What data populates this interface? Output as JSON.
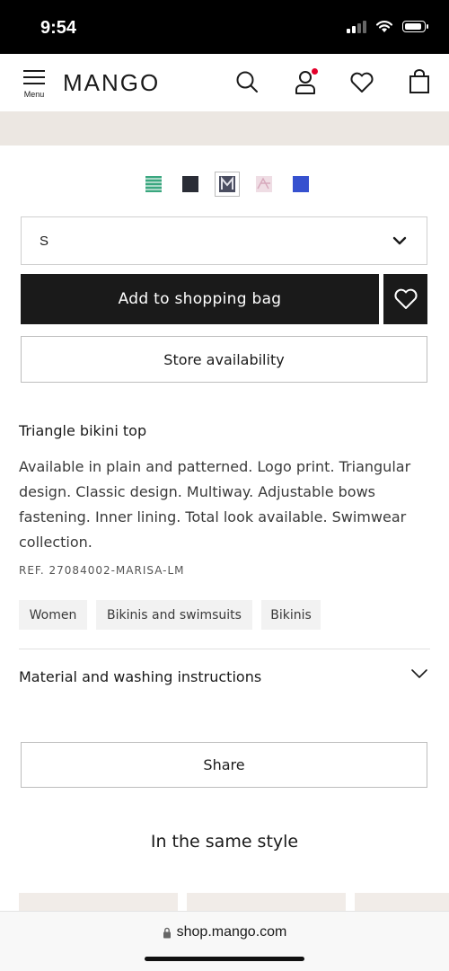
{
  "status_bar": {
    "time": "9:54"
  },
  "header": {
    "menu_label": "Menu",
    "logo": "MANGO",
    "icons": [
      "search-icon",
      "account-icon",
      "heart-icon",
      "shopping-bag-icon"
    ],
    "notification_color": "#e4002b"
  },
  "product": {
    "color_swatches": [
      {
        "name": "green-print",
        "color": "#3aa77f"
      },
      {
        "name": "navy",
        "color": "#2a2d36"
      },
      {
        "name": "navy-print",
        "color": "#4a4d60",
        "selected": true
      },
      {
        "name": "pink-print",
        "color": "#e7c9d4"
      },
      {
        "name": "royal-blue",
        "color": "#3651cf"
      }
    ],
    "size": "S",
    "add_to_bag": "Add to shopping bag",
    "store_availability": "Store availability",
    "name": "Triangle bikini top",
    "description": "Available in plain and patterned. Logo print. Triangular design. Classic design. Multiway. Adjustable bows fastening. Inner lining. Total look available. Swimwear collection.",
    "reference": "REF. 27084002-MARISA-LM",
    "tags": [
      "Women",
      "Bikinis and swimsuits",
      "Bikinis"
    ],
    "material_title": "Material and washing instructions",
    "share": "Share",
    "same_style_title": "In the same style"
  },
  "browser": {
    "url": "shop.mango.com"
  },
  "colors": {
    "primary": "#1a1a1a",
    "banner": "#ece7e2",
    "tag_bg": "#f2f2f2"
  }
}
